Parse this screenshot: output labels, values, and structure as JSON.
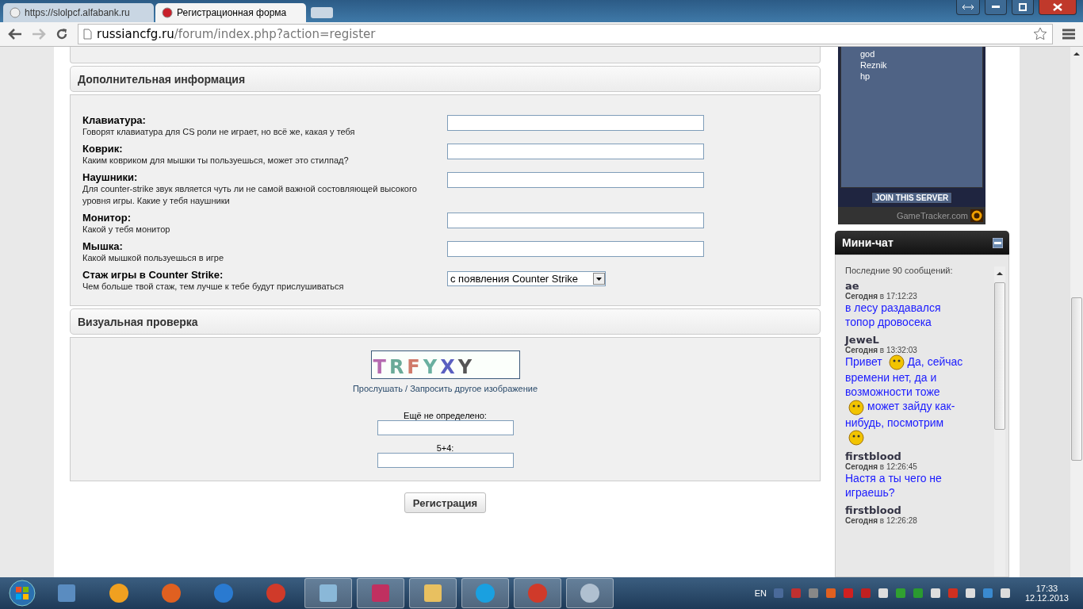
{
  "browser": {
    "tabs": [
      {
        "title": "https://slolpcf.alfabank.ru",
        "selected": false
      },
      {
        "title": "Регистрационная форма",
        "selected": true
      }
    ],
    "url_host": "russiancfg.ru",
    "url_path": "/forum/index.php?action=register"
  },
  "sections": [
    {
      "title": "Дополнительная информация",
      "fields": [
        {
          "kind": "text",
          "label": "Клавиатура:",
          "hint": "Говорят клавиатура для CS роли не играет, но всё же, какая у тебя"
        },
        {
          "kind": "text",
          "label": "Коврик:",
          "hint": "Каким ковриком для мышки ты пользуешься, может это стилпад?"
        },
        {
          "kind": "text",
          "label": "Наушники:",
          "hint": "Для counter-strike звук является чуть ли не самой важной состовляющей высокого уровня игры. Какие у тебя наушники"
        },
        {
          "kind": "text",
          "label": "Монитор:",
          "hint": "Какой у тебя монитор"
        },
        {
          "kind": "text",
          "label": "Мышка:",
          "hint": "Какой мышкой пользуешься в игре"
        },
        {
          "kind": "select",
          "label": "Стаж игры в Counter Strike:",
          "hint": "Чем больше твой стаж, тем лучше к тебе будут прислушиваться",
          "value": "с появления Counter Strike"
        }
      ]
    },
    {
      "title": "Визуальная проверка",
      "captcha": [
        {
          "letter": "T",
          "color": "#b56bb0"
        },
        {
          "letter": "R",
          "color": "#6aaa98"
        },
        {
          "letter": "F",
          "color": "#d07a6a"
        },
        {
          "letter": "Y",
          "color": "#6ab0a0"
        },
        {
          "letter": "X",
          "color": "#5a5fc0"
        },
        {
          "letter": "Y",
          "color": "#555555"
        }
      ],
      "links": [
        "Прослушать",
        "Запросить другое изображение"
      ],
      "link_separator": "/",
      "questions": [
        {
          "label": "Ещё не определено:"
        },
        {
          "label": "5+4:"
        }
      ]
    }
  ],
  "submit": "Регистрация",
  "server": {
    "players": [
      "god",
      "Reznik",
      "hp"
    ],
    "join": "JOIN THIS SERVER",
    "footer": "GameTracker.com"
  },
  "chat": {
    "title": "Мини-чат",
    "summary": "Последние 90 сообщений:",
    "messages": [
      {
        "author": "ae",
        "time": "**Сегодня** в 17:12:23",
        "parts": [
          {
            "kind": "text",
            "text": "в лесу раздавался топор дровосека"
          }
        ]
      },
      {
        "author": "JeweL",
        "time": "**Сегодня** в 13:32:03",
        "parts": [
          {
            "kind": "text",
            "text": "Привет"
          },
          {
            "kind": "smiley"
          },
          {
            "kind": "text",
            "text": "Да, сейчас времени нет, да и возможности тоже"
          },
          {
            "kind": "smiley"
          },
          {
            "kind": "text",
            "text": "может зайду как-нибудь, посмотрим"
          },
          {
            "kind": "smiley"
          }
        ]
      },
      {
        "author": "firstblood",
        "time": "**Сегодня** в 12:26:45",
        "parts": [
          {
            "kind": "text",
            "text": "Настя а ты чего не играешь?"
          }
        ]
      },
      {
        "author": "firstblood",
        "time": "**Сегодня** в 12:26:28"
      }
    ]
  },
  "taskbar": {
    "apps": [
      {
        "kind": "calculator",
        "running": false
      },
      {
        "kind": "outlook",
        "running": false
      },
      {
        "kind": "firefox",
        "running": false
      },
      {
        "kind": "ie",
        "running": false
      },
      {
        "kind": "chrome",
        "running": false
      },
      {
        "kind": "notepad",
        "running": true
      },
      {
        "kind": "archive",
        "running": true
      },
      {
        "kind": "explorer",
        "running": true
      },
      {
        "kind": "skype",
        "running": true
      },
      {
        "kind": "chrome",
        "running": true
      },
      {
        "kind": "paint",
        "running": true
      }
    ],
    "language": "EN",
    "time": "17:33",
    "date": "12.12.2013"
  }
}
